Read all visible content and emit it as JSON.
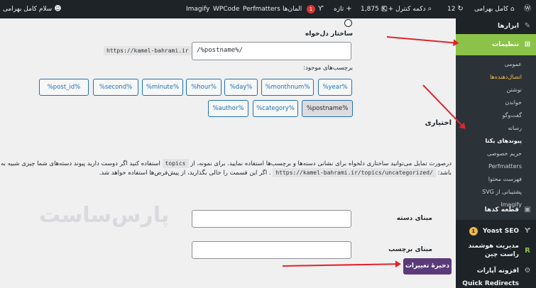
{
  "adminbar": {
    "wp_logo": "wordpress-logo-icon",
    "site_name": "کامل بهرامی",
    "updates": "12",
    "search_label": "دکمه کنترل + K",
    "comments": "1,875",
    "new_label": "تازه",
    "yoast_badge": "1",
    "elementor_label": "المان‌ها",
    "perfmatters": "Perfmatters",
    "wpcode": "WPCode",
    "imagify": "Imagify",
    "greeting": "سلام کامل بهرامی"
  },
  "sidebar": {
    "tools": "ابزارها",
    "settings": "تنظیمات",
    "settings_sub": [
      "عمومی",
      "اتصال‌دهنده‌ها",
      "نوشتن",
      "خواندن",
      "گفت‌وگو",
      "رسانه",
      "پیوندهای یکتا",
      "حریم خصوصی",
      "Perfmatters",
      "فهرست محتوا",
      "پشتیبانی از SVG",
      "Imagify"
    ],
    "snippets": "قطعه کدها",
    "yoast": "Yoast SEO",
    "yoast_badge": "1",
    "perf_manager_1": "مدیریت هوشمند",
    "perf_manager_2": "راست چین",
    "addons": "افزونه آپارات",
    "quick_redirects": "Quick Redirects"
  },
  "content": {
    "custom_structure_label": "ساختار دل‌خواه",
    "base_url": "https://kamel-bahrami.ir",
    "structure_value": "/%postname%/",
    "available_tags_label": "برچسب‌های موجود:",
    "tags_row1": [
      "%year%",
      "%monthnum%",
      "%day%",
      "%hour%",
      "%minute%",
      "%second%",
      "%post_id%"
    ],
    "tags_row2": [
      "%postname%",
      "%category%",
      "%author%"
    ],
    "optional_title": "اختیاری",
    "optional_desc_1a": "درصورت تمایل می‌توانید ساختاری دلخواه برای نشانی دسته‌ها و برچسب‌ها استفاده نمایید. برای نمونه، از",
    "topics_code": "topics",
    "optional_desc_1b": "استفاده کنید اگر دوست دارید پیوند دسته‌های شما چیزی شبیه به این",
    "optional_desc_2a": "باشد:",
    "example_url": "https://kamel-bahrami.ir/topics/uncategorized/",
    "optional_desc_2b": ". اگر این قسمت را خالی بگذارید، از پیش‌فرض‌ها استفاده خواهد شد.",
    "category_base_label": "مبنای دسته",
    "category_base_value": "",
    "tag_base_label": "مبنای برچسب",
    "tag_base_value": "",
    "save_button": "ذخیرهٔ تغییرات",
    "watermark": "پارس‌ساست"
  }
}
